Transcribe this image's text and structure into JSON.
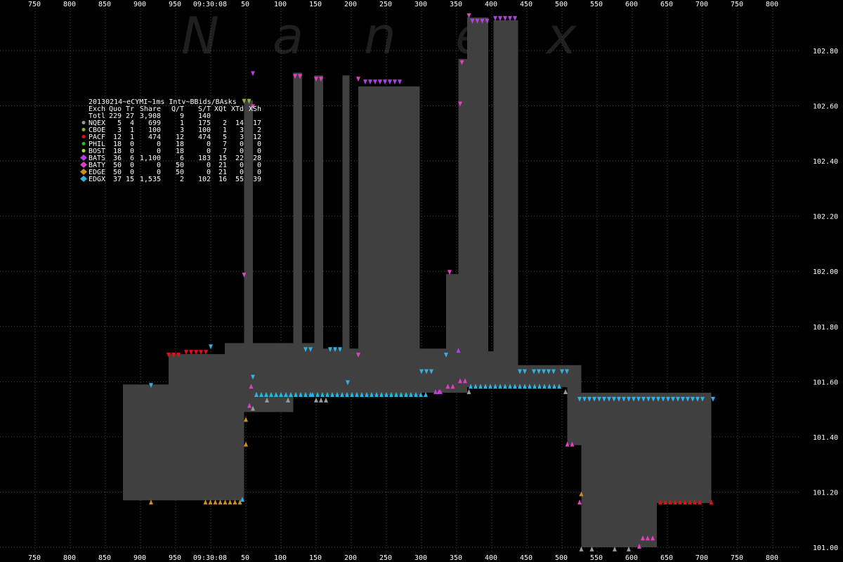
{
  "chart_data": {
    "type": "area",
    "title": "20130214~eCYMI~1ms Intv~BBids/BAsks",
    "watermark": [
      "N",
      "a",
      "n",
      "e",
      "x"
    ],
    "time_label": "09:30:08",
    "xlabel": "",
    "ylabel": "",
    "x_top_ticks": [
      "750",
      "800",
      "850",
      "900",
      "950",
      "09:30:08",
      "50",
      "100",
      "150",
      "200",
      "250",
      "300",
      "350",
      "400",
      "450",
      "500",
      "550",
      "600",
      "650",
      "700",
      "750",
      "800"
    ],
    "x_bottom_ticks": [
      "750",
      "800",
      "850",
      "900",
      "950",
      "09:30:08",
      "50",
      "100",
      "150",
      "200",
      "250",
      "300",
      "350",
      "400",
      "450",
      "500",
      "550",
      "600",
      "650",
      "700",
      "750",
      "800"
    ],
    "y_ticks": [
      101.0,
      101.2,
      101.4,
      101.6,
      101.8,
      102.0,
      102.2,
      102.4,
      102.6,
      102.8
    ],
    "ylim": [
      100.97,
      102.98
    ],
    "grid": true,
    "legend_placement": "top-left",
    "legend_header": [
      "Exch",
      "Quo",
      "Tr",
      "Share",
      "Q/T",
      "S/T",
      "XQt",
      "XTd",
      "XSh"
    ],
    "legend_rows": [
      {
        "exch": "Totl",
        "quo": "229",
        "tr": "27",
        "share": "3,908",
        "qt": "9",
        "st": "140",
        "xqt": "",
        "xtd": "",
        "xsh": "",
        "color": "",
        "marker": "none"
      },
      {
        "exch": "NQEX",
        "quo": "5",
        "tr": "4",
        "share": "699",
        "qt": "1",
        "st": "175",
        "xqt": "2",
        "xtd": "14",
        "xsh": "17",
        "color": "#9a9a9a",
        "marker": "circle"
      },
      {
        "exch": "CBOE",
        "quo": "3",
        "tr": "1",
        "share": "100",
        "qt": "3",
        "st": "100",
        "xqt": "1",
        "xtd": "3",
        "xsh": "2",
        "color": "#8ab03a",
        "marker": "circle"
      },
      {
        "exch": "PACF",
        "quo": "12",
        "tr": "1",
        "share": "474",
        "qt": "12",
        "st": "474",
        "xqt": "5",
        "xtd": "3",
        "xsh": "12",
        "color": "#e01010",
        "marker": "circle"
      },
      {
        "exch": "PHIL",
        "quo": "18",
        "tr": "0",
        "share": "0",
        "qt": "18",
        "st": "0",
        "xqt": "7",
        "xtd": "0",
        "xsh": "0",
        "color": "#22c022",
        "marker": "circle"
      },
      {
        "exch": "BOST",
        "quo": "18",
        "tr": "0",
        "share": "0",
        "qt": "18",
        "st": "0",
        "xqt": "7",
        "xtd": "0",
        "xsh": "0",
        "color": "#b0e020",
        "marker": "circle"
      },
      {
        "exch": "BATS",
        "quo": "36",
        "tr": "6",
        "share": "1,100",
        "qt": "6",
        "st": "183",
        "xqt": "15",
        "xtd": "22",
        "xsh": "28",
        "color": "#b040e0",
        "marker": "diamond"
      },
      {
        "exch": "BATY",
        "quo": "50",
        "tr": "0",
        "share": "0",
        "qt": "50",
        "st": "0",
        "xqt": "21",
        "xtd": "0",
        "xsh": "0",
        "color": "#e040c0",
        "marker": "diamond"
      },
      {
        "exch": "EDGE",
        "quo": "50",
        "tr": "0",
        "share": "0",
        "qt": "50",
        "st": "0",
        "xqt": "21",
        "xtd": "0",
        "xsh": "0",
        "color": "#d08a20",
        "marker": "diamond"
      },
      {
        "exch": "EDGX",
        "quo": "37",
        "tr": "15",
        "share": "1,535",
        "qt": "2",
        "st": "102",
        "xqt": "16",
        "xtd": "55",
        "xsh": "39",
        "color": "#30b0e0",
        "marker": "diamond"
      }
    ],
    "spread_segments": [
      {
        "t": [
          -25,
          9.5
        ],
        "bid": 101.17,
        "ask": 101.59
      },
      {
        "t": [
          -12,
          4
        ],
        "bid": 101.56,
        "ask": 101.7
      },
      {
        "t": [
          4,
          23.5
        ],
        "bid": 101.49,
        "ask": 101.74
      },
      {
        "t": [
          9.5,
          12
        ],
        "bid": 101.56,
        "ask": 102.62
      },
      {
        "t": [
          23.5,
          26
        ],
        "bid": 101.55,
        "ask": 102.72
      },
      {
        "t": [
          26,
          29.5
        ],
        "bid": 101.55,
        "ask": 101.74
      },
      {
        "t": [
          29.5,
          32
        ],
        "bid": 101.55,
        "ask": 102.71
      },
      {
        "t": [
          32,
          37.5
        ],
        "bid": 101.55,
        "ask": 101.72
      },
      {
        "t": [
          37.5,
          39.5
        ],
        "bid": 101.55,
        "ask": 102.71
      },
      {
        "t": [
          39.5,
          42
        ],
        "bid": 101.55,
        "ask": 101.72
      },
      {
        "t": [
          42,
          59.5
        ],
        "bid": 101.55,
        "ask": 102.67
      },
      {
        "t": [
          59.5,
          67
        ],
        "bid": 101.56,
        "ask": 101.72
      },
      {
        "t": [
          67,
          70.5
        ],
        "bid": 101.56,
        "ask": 101.99
      },
      {
        "t": [
          70.5,
          73
        ],
        "bid": 101.56,
        "ask": 102.77
      },
      {
        "t": [
          73,
          79
        ],
        "bid": 101.58,
        "ask": 102.92
      },
      {
        "t": [
          79,
          80.5
        ],
        "bid": 101.58,
        "ask": 101.71
      },
      {
        "t": [
          80.5,
          87.5
        ],
        "bid": 101.58,
        "ask": 102.91
      },
      {
        "t": [
          87.5,
          101.5
        ],
        "bid": 101.58,
        "ask": 101.66
      },
      {
        "t": [
          101.5,
          105.5
        ],
        "bid": 101.37,
        "ask": 101.66
      },
      {
        "t": [
          105.5,
          127
        ],
        "bid": 101.0,
        "ask": 101.56
      },
      {
        "t": [
          127,
          142.5
        ],
        "bid": 101.16,
        "ask": 101.56
      }
    ],
    "bid_markers": [
      {
        "exch": "EDGE",
        "t": [
          -1.5,
          9
        ],
        "price": 101.16
      },
      {
        "exch": "EDGE",
        "t": [
          -17,
          -17
        ],
        "price": 101.16
      },
      {
        "exch": "EDGE",
        "t": [
          10,
          10
        ],
        "price": 101.37
      },
      {
        "exch": "EDGE",
        "t": [
          10,
          10
        ],
        "price": 101.46
      },
      {
        "exch": "EDGX",
        "t": [
          9,
          9
        ],
        "price": 101.17
      },
      {
        "exch": "BATY",
        "t": [
          11,
          11
        ],
        "price": 101.51
      },
      {
        "exch": "BATY",
        "t": [
          11.5,
          11.5
        ],
        "price": 101.58
      },
      {
        "exch": "NQEX",
        "t": [
          12,
          12
        ],
        "price": 101.5
      },
      {
        "exch": "NQEX",
        "t": [
          13,
          13
        ],
        "price": 101.55
      },
      {
        "exch": "EDGX",
        "t": [
          13,
          29
        ],
        "price": 101.55
      },
      {
        "exch": "NQEX",
        "t": [
          16,
          17
        ],
        "price": 101.53
      },
      {
        "exch": "NQEX",
        "t": [
          22,
          22
        ],
        "price": 101.53
      },
      {
        "exch": "NQEX",
        "t": [
          30,
          34
        ],
        "price": 101.53
      },
      {
        "exch": "EDGX",
        "t": [
          29,
          62
        ],
        "price": 101.55
      },
      {
        "exch": "BATY",
        "t": [
          65,
          65
        ],
        "price": 101.56
      },
      {
        "exch": "BATS",
        "t": [
          64,
          66.5
        ],
        "price": 101.56
      },
      {
        "exch": "BATY",
        "t": [
          67.5,
          69.5
        ],
        "price": 101.58
      },
      {
        "exch": "BATS",
        "t": [
          70.5,
          70.5
        ],
        "price": 101.71
      },
      {
        "exch": "BATY",
        "t": [
          71,
          73
        ],
        "price": 101.6
      },
      {
        "exch": "NQEX",
        "t": [
          73.5,
          73.5
        ],
        "price": 101.56
      },
      {
        "exch": "EDGX",
        "t": [
          74,
          100.5
        ],
        "price": 101.58
      },
      {
        "exch": "BATY",
        "t": [
          101.5,
          104
        ],
        "price": 101.37
      },
      {
        "exch": "NQEX",
        "t": [
          101,
          101
        ],
        "price": 101.56
      },
      {
        "exch": "BATY",
        "t": [
          105,
          105
        ],
        "price": 101.16
      },
      {
        "exch": "EDGE",
        "t": [
          105.5,
          105.5
        ],
        "price": 101.19
      },
      {
        "exch": "NQEX",
        "t": [
          105.5,
          106
        ],
        "price": 100.99
      },
      {
        "exch": "NQEX",
        "t": [
          108.5,
          109.5
        ],
        "price": 100.99
      },
      {
        "exch": "NQEX",
        "t": [
          115,
          115
        ],
        "price": 100.99
      },
      {
        "exch": "NQEX",
        "t": [
          119,
          119.5
        ],
        "price": 100.99
      },
      {
        "exch": "BATY",
        "t": [
          122,
          122
        ],
        "price": 101.0
      },
      {
        "exch": "BATY",
        "t": [
          123,
          126
        ],
        "price": 101.03
      },
      {
        "exch": "PACF",
        "t": [
          128,
          140
        ],
        "price": 101.16
      },
      {
        "exch": "PACF",
        "t": [
          142.5,
          142.5
        ],
        "price": 101.16
      }
    ],
    "ask_markers": [
      {
        "exch": "EDGX",
        "t": [
          -17,
          -17
        ],
        "price": 101.59
      },
      {
        "exch": "PACF",
        "t": [
          -12,
          -8
        ],
        "price": 101.7
      },
      {
        "exch": "PACF",
        "t": [
          -7,
          -1
        ],
        "price": 101.71
      },
      {
        "exch": "EDGX",
        "t": [
          0,
          0
        ],
        "price": 101.73
      },
      {
        "exch": "CBOE",
        "t": [
          9.5,
          11.5
        ],
        "price": 102.62
      },
      {
        "exch": "BATY",
        "t": [
          9.5,
          9.5
        ],
        "price": 101.99
      },
      {
        "exch": "BATS",
        "t": [
          12,
          12
        ],
        "price": 102.72
      },
      {
        "exch": "BATY",
        "t": [
          12,
          12
        ],
        "price": 102.6
      },
      {
        "exch": "EDGX",
        "t": [
          12,
          12
        ],
        "price": 101.62
      },
      {
        "exch": "BATY",
        "t": [
          24,
          26
        ],
        "price": 102.71
      },
      {
        "exch": "EDGX",
        "t": [
          27,
          29
        ],
        "price": 101.72
      },
      {
        "exch": "BATY",
        "t": [
          30,
          32
        ],
        "price": 102.7
      },
      {
        "exch": "EDGX",
        "t": [
          34,
          38
        ],
        "price": 101.72
      },
      {
        "exch": "EDGX",
        "t": [
          39,
          39
        ],
        "price": 101.6
      },
      {
        "exch": "BATY",
        "t": [
          42,
          43
        ],
        "price": 102.7
      },
      {
        "exch": "BATS",
        "t": [
          44,
          55
        ],
        "price": 102.69
      },
      {
        "exch": "BATY",
        "t": [
          42,
          42
        ],
        "price": 101.7
      },
      {
        "exch": "EDGX",
        "t": [
          60,
          64
        ],
        "price": 101.64
      },
      {
        "exch": "EDGX",
        "t": [
          67,
          67
        ],
        "price": 101.7
      },
      {
        "exch": "BATY",
        "t": [
          68,
          68
        ],
        "price": 102.0
      },
      {
        "exch": "BATY",
        "t": [
          71,
          71
        ],
        "price": 102.61
      },
      {
        "exch": "BATY",
        "t": [
          71.5,
          72.5
        ],
        "price": 102.76
      },
      {
        "exch": "BATY",
        "t": [
          73.5,
          74
        ],
        "price": 102.93
      },
      {
        "exch": "BATS",
        "t": [
          74.5,
          79
        ],
        "price": 102.91
      },
      {
        "exch": "BATS",
        "t": [
          81,
          87
        ],
        "price": 102.92
      },
      {
        "exch": "EDGX",
        "t": [
          88,
          89.5
        ],
        "price": 101.64
      },
      {
        "exch": "EDGX",
        "t": [
          92,
          98
        ],
        "price": 101.64
      },
      {
        "exch": "EDGX",
        "t": [
          100,
          101.5
        ],
        "price": 101.64
      },
      {
        "exch": "EDGX",
        "t": [
          105,
          140
        ],
        "price": 101.54
      },
      {
        "exch": "EDGX",
        "t": [
          143,
          143
        ],
        "price": 101.54
      }
    ]
  }
}
